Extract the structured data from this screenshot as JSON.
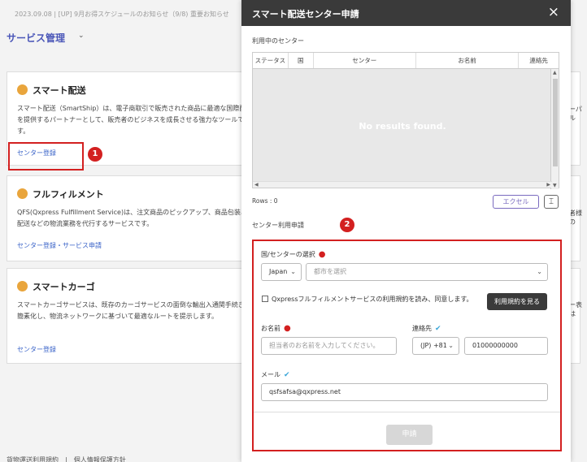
{
  "background": {
    "notice": "2023.09.08 | [UP] 9月お得スケジュールのお知らせ（9/8) 重要お知らせ",
    "service_title": "サービス管理",
    "cards": [
      {
        "title": "スマート配送",
        "desc": "スマート配送（SmartShip）は、電子商取引で販売された商品に最適な国際配送を提供するパートナーとして、販売者のビジネスを成長させる強力なツールです。",
        "link": "センター登録",
        "overflow": "ーパル"
      },
      {
        "title": "フルフィルメント",
        "desc": "QFS(Qxpress Fulfillment Service)は、注文商品のピックアップ、商品包装、配送などの物流業務を代行するサービスです。",
        "link": "センター登録・サービス申請",
        "overflow": "者様の"
      },
      {
        "title": "スマートカーゴ",
        "desc": "スマートカーゴサービスは、既存のカーゴサービスの面倒な輸出入通関手続きを簡素化し、物流ネットワークに基づいて最適なルートを提示します。",
        "link": "センター登録",
        "overflow": "ー表は"
      }
    ],
    "footer": "貨物運送利用規約　|　個人情報保護方針",
    "annotations": [
      "1",
      "2"
    ]
  },
  "modal": {
    "title": "スマート配送センター申請",
    "close_icon": "×",
    "in_use_label": "利用中のセンター",
    "grid": {
      "columns": [
        "ステータス",
        "国",
        "センター",
        "お名前",
        "連絡先"
      ],
      "empty_text": "No results found."
    },
    "rows_label": "Rows : 0",
    "excel_label": "エクセル",
    "fit_icon": "⌶",
    "apply_section_label": "センター利用申請",
    "form": {
      "country_center_label": "国/センターの選択",
      "country_value": "Japan",
      "city_placeholder": "都市を選択",
      "terms_text": "Qxpressフルフィルメントサービスの利用規約を読み、同意します。",
      "terms_button": "利用規約を見る",
      "name_label": "お名前",
      "name_placeholder": "担当者のお名前を入力してください。",
      "contact_label": "連絡先",
      "phone_code": "(JP) +81",
      "phone_value": "01000000000",
      "email_label": "メール",
      "email_value": "qsfsafsa@qxpress.net",
      "apply_button": "申請"
    }
  }
}
